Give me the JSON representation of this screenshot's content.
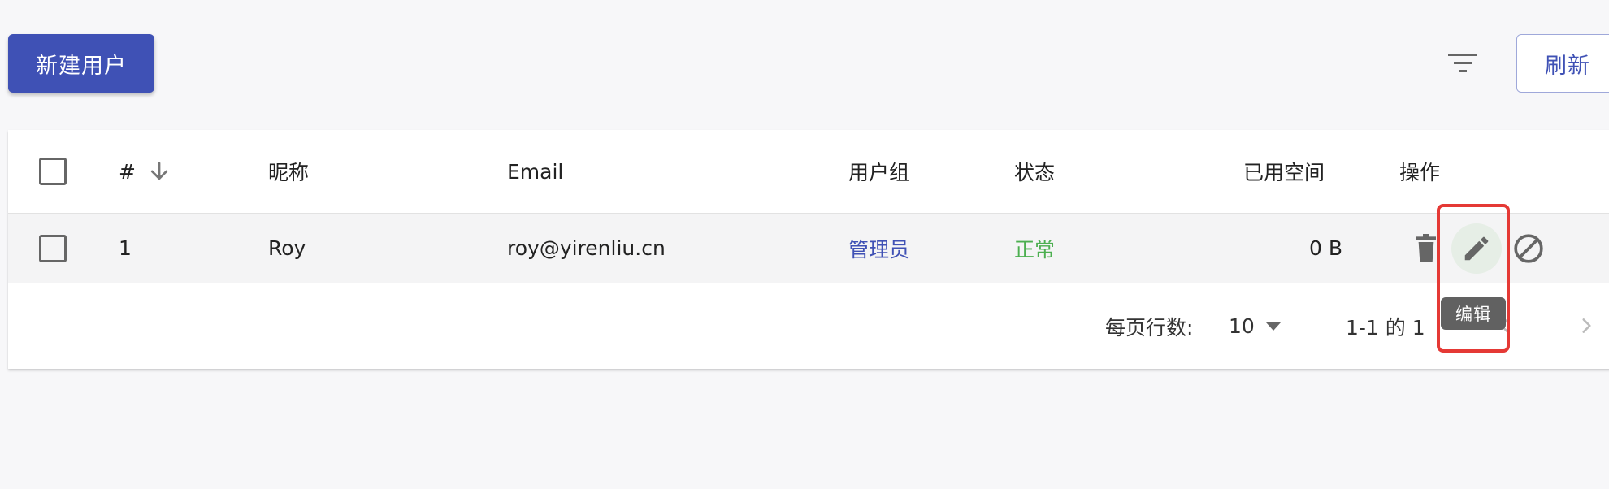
{
  "toolbar": {
    "new_user_label": "新建用户",
    "filter_icon": "filter-list-icon",
    "refresh_label": "刷新"
  },
  "table": {
    "columns": [
      "#",
      "昵称",
      "Email",
      "用户组",
      "状态",
      "已用空间",
      "操作"
    ],
    "sort_icon": "arrow-down-icon",
    "rows": [
      {
        "id": "1",
        "nickname": "Roy",
        "email": "roy@yirenliu.cn",
        "group": "管理员",
        "status": "正常",
        "used_space": "0 B",
        "actions": [
          "delete-icon",
          "edit-icon",
          "ban-icon"
        ]
      }
    ]
  },
  "pagination": {
    "rows_per_page_label": "每页行数:",
    "rows_per_page_value": "10",
    "range_text": "1-1 的 1"
  },
  "tooltip": {
    "text": "编辑"
  },
  "colors": {
    "primary": "#3f51b5",
    "success": "#4caf50",
    "highlight": "#e53935",
    "tooltip_bg": "#616161"
  }
}
